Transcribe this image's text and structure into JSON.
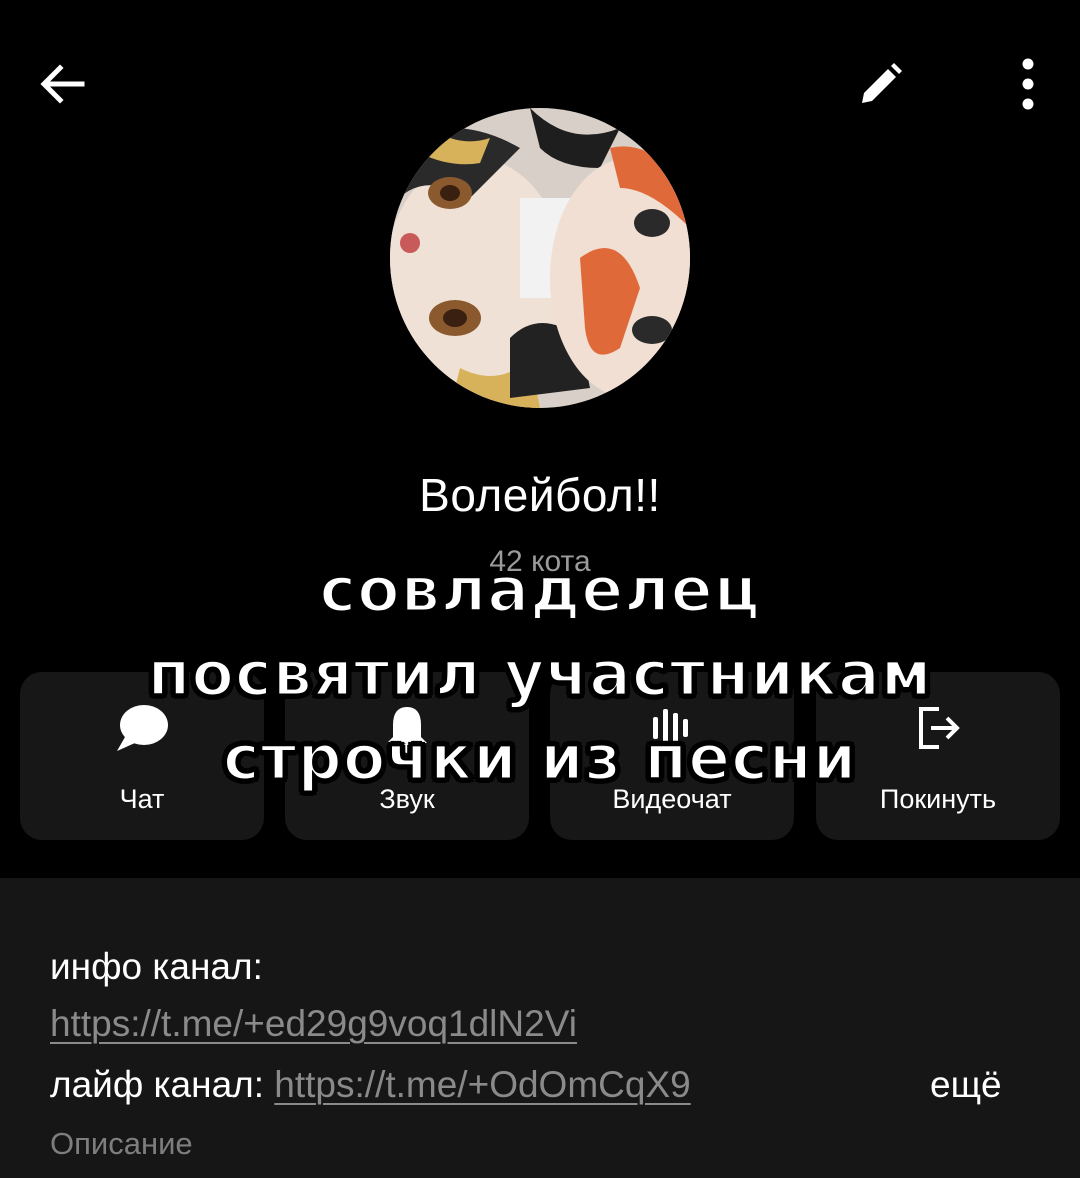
{
  "header": {
    "back_icon": "arrow-left-icon",
    "edit_icon": "pencil-icon",
    "more_icon": "more-vertical-icon"
  },
  "profile": {
    "name": "Волейбол!!",
    "members": "42 кота",
    "avatar_desc": "avatar-image"
  },
  "actions": [
    {
      "label": "Чат",
      "icon": "chat-bubble-icon"
    },
    {
      "label": "Звук",
      "icon": "bell-icon"
    },
    {
      "label": "Видеочат",
      "icon": "voice-chat-icon"
    },
    {
      "label": "Покинуть",
      "icon": "leave-icon"
    }
  ],
  "overlay": {
    "line1": "совладелец",
    "line2": "посвятил участникам",
    "line3": "строчки из песни"
  },
  "info": {
    "line1_label": "инфо канал:",
    "line1_link": "https://t.me/+ed29g9voq1dlN2Vi",
    "line2_label": "лайф канал:",
    "line2_link": "https://t.me/+OdOmCqX9",
    "more": "ещё",
    "description_label": "Описание"
  },
  "colors": {
    "background": "#000000",
    "card": "#171717",
    "info_bg": "#161616",
    "muted_text": "#8a8a8a"
  }
}
